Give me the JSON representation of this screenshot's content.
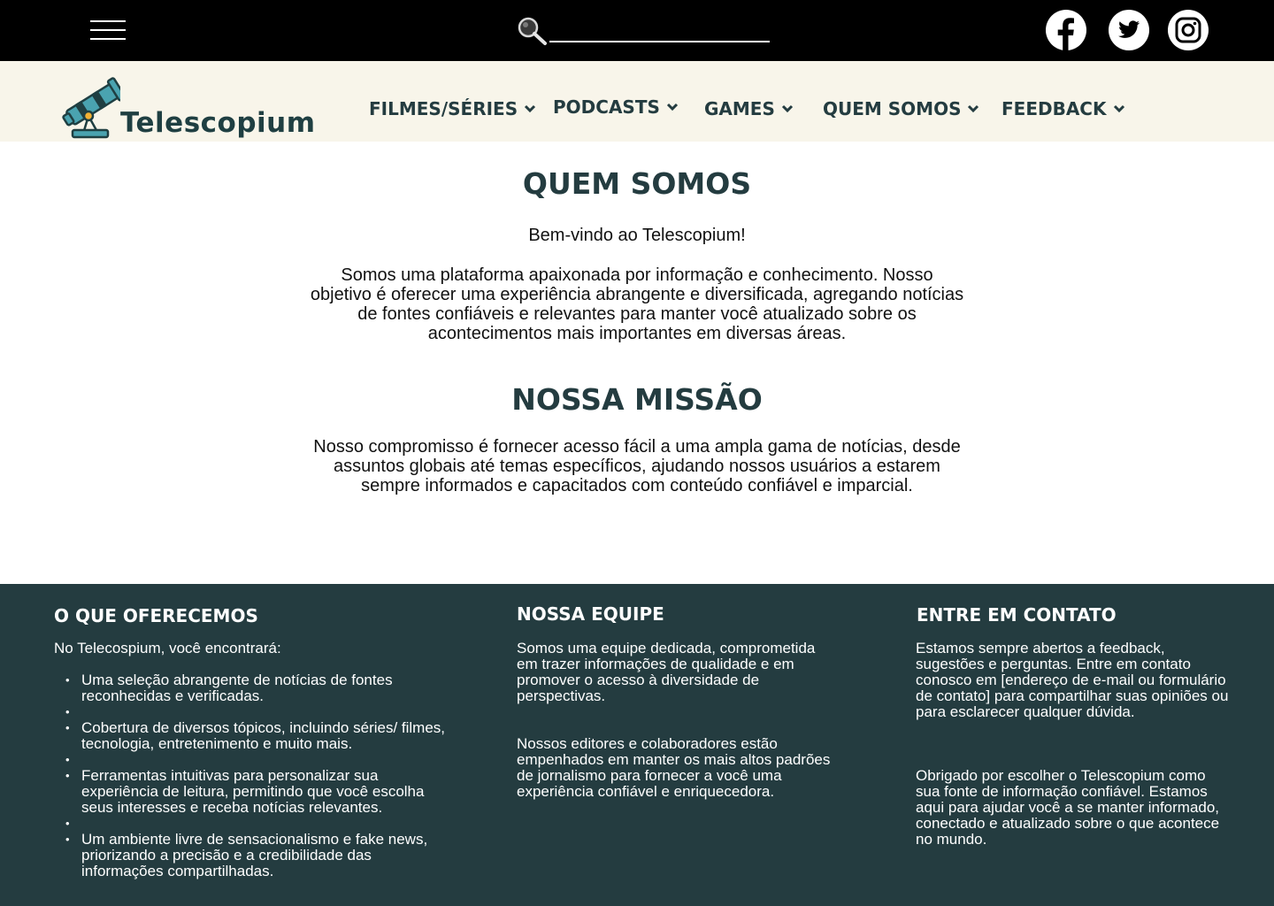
{
  "header": {
    "search": {
      "value": "",
      "placeholder": ""
    },
    "social": [
      {
        "name": "facebook-icon"
      },
      {
        "name": "twitter-icon"
      },
      {
        "name": "instagram-icon"
      }
    ]
  },
  "brand": {
    "name": "Telescopium"
  },
  "nav": {
    "items": [
      {
        "label": "FILMES/SÉRIES"
      },
      {
        "label": "PODCASTS"
      },
      {
        "label": "GAMES"
      },
      {
        "label": "QUEM SOMOS"
      },
      {
        "label": "FEEDBACK"
      }
    ]
  },
  "main": {
    "title": "QUEM SOMOS",
    "welcome": "Bem-vindo ao Telescopium!",
    "intro": "Somos uma plataforma apaixonada por informação e conhecimento. Nosso objetivo é oferecer uma experiência abrangente e diversificada, agregando notícias de fontes confiáveis e relevantes para manter você atualizado sobre os acontecimentos mais importantes em diversas áreas.",
    "mission_title": "NOSSA MISSÃO",
    "mission_text": "Nosso compromisso é fornecer acesso fácil a uma ampla gama de notícias, desde assuntos globais até temas específicos, ajudando nossos usuários a estarem sempre informados e capacitados com conteúdo confiável e imparcial."
  },
  "footer": {
    "offer": {
      "title": "O QUE OFERECEMOS",
      "intro": "No Telecospium, você encontrará:",
      "items": [
        "Uma seleção abrangente de notícias de fontes reconhecidas e verificadas.",
        "",
        "Cobertura de diversos tópicos, incluindo séries/ filmes, tecnologia, entretenimento e muito mais.",
        "",
        "Ferramentas intuitivas para personalizar sua experiência de leitura, permitindo que você escolha seus interesses e receba notícias relevantes.",
        "",
        "Um ambiente livre de sensacionalismo e fake news, priorizando a precisão e a credibilidade das informações compartilhadas."
      ]
    },
    "team": {
      "title": "NOSSA EQUIPE",
      "p1": "Somos uma equipe dedicada, comprometida em trazer informações de qualidade e em promover o acesso à diversidade de perspectivas.",
      "p2": "Nossos editores e colaboradores estão empenhados em manter os mais altos padrões de jornalismo para fornecer a você uma experiência confiável e enriquecedora."
    },
    "contact": {
      "title": "ENTRE EM CONTATO",
      "p1": "Estamos sempre abertos a feedback, sugestões e perguntas. Entre em contato conosco em [endereço de e-mail ou formulário de contato] para compartilhar suas opiniões ou para esclarecer qualquer dúvida.",
      "p2": "Obrigado por escolher o Telescopium como sua fonte de informação confiável. Estamos aqui para ajudar você a se manter informado, conectado e atualizado sobre o que acontece no mundo."
    }
  },
  "colors": {
    "topbar": "#000000",
    "navbar": "#f8f5ea",
    "heading": "#243c40",
    "footer": "#243c40",
    "logo_teal": "#4aa3b0",
    "logo_accent": "#f2b134"
  }
}
